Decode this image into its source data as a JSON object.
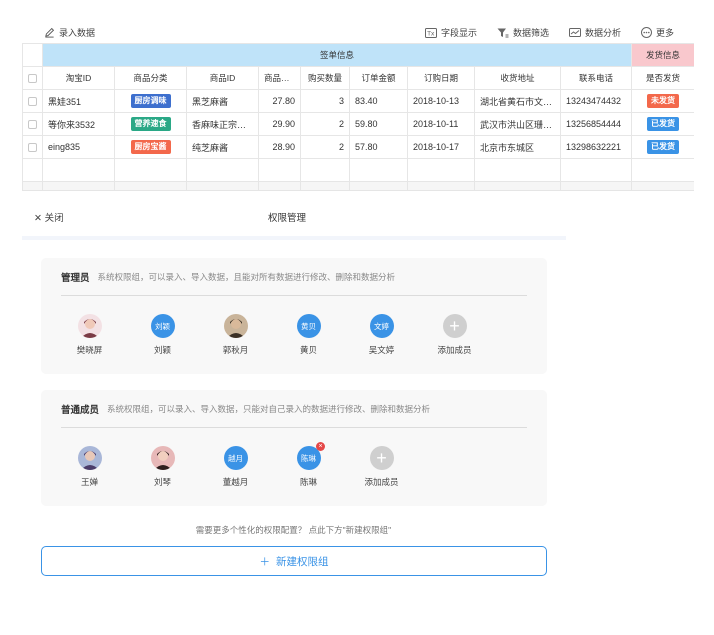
{
  "toolbar": {
    "import_label": "录入数据",
    "actions": [
      {
        "label": "字段显示",
        "icon": "field-display-icon"
      },
      {
        "label": "数据筛选",
        "icon": "filter-icon"
      },
      {
        "label": "数据分析",
        "icon": "analysis-icon"
      },
      {
        "label": "更多",
        "icon": "more-icon"
      }
    ]
  },
  "table": {
    "group_order_label": "签单信息",
    "group_ship_label": "发货信息",
    "headers": [
      "淘宝ID",
      "商品分类",
      "商品ID",
      "商品价格",
      "购买数量",
      "订单金额",
      "订购日期",
      "收货地址",
      "联系电话",
      "是否发货"
    ],
    "rows": [
      {
        "taobao_id": "黑娃351",
        "category": "厨房调味",
        "category_color": "#3d6fce",
        "product_id": "黑芝麻酱",
        "price": "27.80",
        "qty": "3",
        "amount": "83.40",
        "date": "2018-10-13",
        "address": "湖北省黄石市文化...",
        "phone": "13243474432",
        "shipped": "未发货",
        "shipped_color": "#f3684b"
      },
      {
        "taobao_id": "等你来3532",
        "category": "营养速食",
        "category_color": "#2aa886",
        "product_id": "香麻味正宗热...",
        "price": "29.90",
        "qty": "2",
        "amount": "59.80",
        "date": "2018-10-11",
        "address": "武汉市洪山区珊光...",
        "phone": "13256854444",
        "shipped": "已发货",
        "shipped_color": "#3a93e6"
      },
      {
        "taobao_id": "eing835",
        "category": "厨房宝酱",
        "category_color": "#f3684b",
        "product_id": "纯芝麻酱",
        "price": "28.90",
        "qty": "2",
        "amount": "57.80",
        "date": "2018-10-17",
        "address": "北京市东城区",
        "phone": "13298632221",
        "shipped": "已发货",
        "shipped_color": "#3a93e6"
      }
    ]
  },
  "panel": {
    "close_label": "关闭",
    "title": "权限管理"
  },
  "roles": {
    "admin": {
      "title": "管理员",
      "description": "系统权限组，可以录入、导入数据，且能对所有数据进行修改、删除和数据分析",
      "members": [
        {
          "name": "樊晓屏",
          "avatar_text": "",
          "avatar_type": "photo",
          "icon": "user-photo-icon"
        },
        {
          "name": "刘颖",
          "avatar_text": "刘颖",
          "avatar_type": "text"
        },
        {
          "name": "郭秋月",
          "avatar_text": "",
          "avatar_type": "photo",
          "icon": "user-photo-icon"
        },
        {
          "name": "黄贝",
          "avatar_text": "黄贝",
          "avatar_type": "text"
        },
        {
          "name": "吴文婷",
          "avatar_text": "文婷",
          "avatar_type": "text"
        }
      ],
      "add_label": "添加成员"
    },
    "member": {
      "title": "普通成员",
      "description": "系统权限组，可以录入、导入数据，只能对自己录入的数据进行修改、删除和数据分析",
      "members": [
        {
          "name": "王婵",
          "avatar_text": "",
          "avatar_type": "photo",
          "icon": "user-photo-icon"
        },
        {
          "name": "刘琴",
          "avatar_text": "",
          "avatar_type": "photo",
          "icon": "user-photo-icon"
        },
        {
          "name": "董越月",
          "avatar_text": "越月",
          "avatar_type": "text"
        },
        {
          "name": "陈琳",
          "avatar_text": "陈琳",
          "avatar_type": "text",
          "removable": true
        }
      ],
      "add_label": "添加成员"
    }
  },
  "footer": {
    "hint": "需要更多个性化的权限配置？ 点此下方\"新建权限组\"",
    "new_group_label": "新建权限组"
  }
}
